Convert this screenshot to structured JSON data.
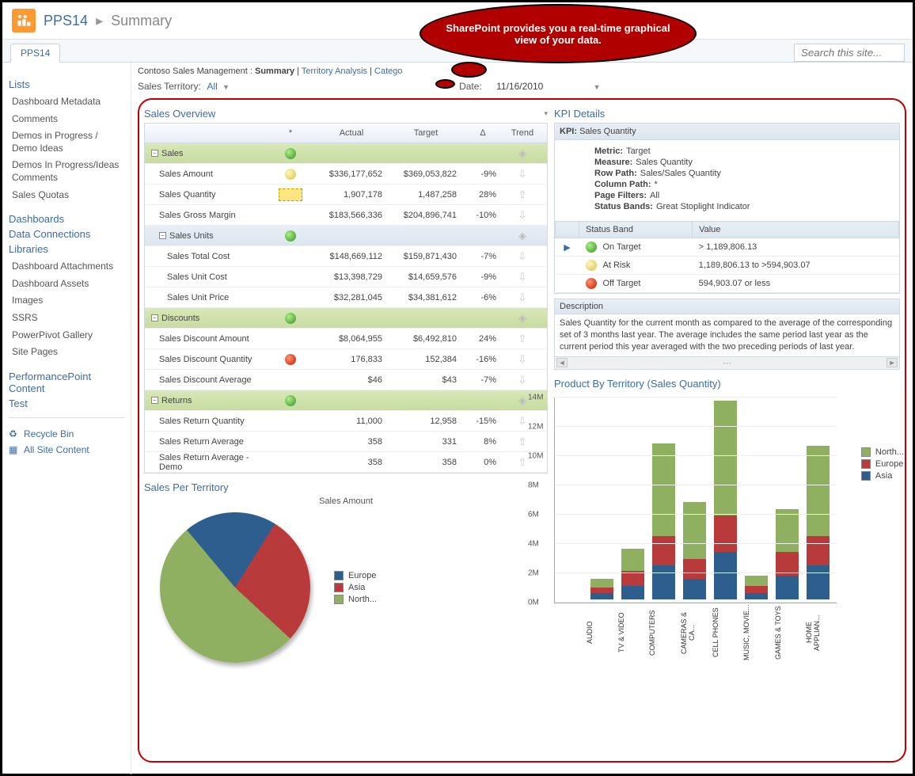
{
  "header": {
    "site": "PPS14",
    "page": "Summary",
    "tab": "PPS14",
    "search_placeholder": "Search this site..."
  },
  "callout": "SharePoint provides you a real-time graphical view of your data.",
  "sidebar": {
    "lists_header": "Lists",
    "lists": [
      "Dashboard Metadata",
      "Comments",
      "Demos in Progress / Demo Ideas",
      "Demos In Progress/Ideas Comments",
      "Sales Quotas"
    ],
    "dashboards": "Dashboards",
    "data_connections": "Data Connections",
    "libraries_header": "Libraries",
    "libraries": [
      "Dashboard Attachments",
      "Dashboard Assets",
      "Images",
      "SSRS",
      "PowerPivot Gallery",
      "Site Pages"
    ],
    "pp_content": "PerformancePoint Content",
    "test": "Test",
    "recycle": "Recycle Bin",
    "all_content": "All Site Content"
  },
  "crumbs": {
    "root": "Contoso Sales Management :",
    "current": "Summary",
    "links": [
      "Territory Analysis",
      "Catego"
    ]
  },
  "filters": {
    "territory_label": "Sales Territory:",
    "territory_value": "All",
    "date_label": "Date:",
    "date_value": "11/16/2010"
  },
  "overview": {
    "title": "Sales Overview",
    "columns": [
      "",
      "*",
      "Actual",
      "Target",
      "Δ",
      "Trend"
    ],
    "rows": [
      {
        "type": "group",
        "label": "Sales",
        "status": "green"
      },
      {
        "type": "item",
        "indent": 1,
        "label": "Sales Amount",
        "status": "yellow",
        "actual": "$336,177,652",
        "target": "$369,053,822",
        "delta": "-9%"
      },
      {
        "type": "item",
        "indent": 1,
        "label": "Sales Quantity",
        "status": "diamond",
        "actual": "1,907,178",
        "target": "1,487,258",
        "delta": "28%"
      },
      {
        "type": "item",
        "indent": 1,
        "label": "Sales Gross Margin",
        "actual": "$183,566,336",
        "target": "$204,896,741",
        "delta": "-10%"
      },
      {
        "type": "subgroup",
        "indent": 1,
        "label": "Sales Units",
        "status": "green"
      },
      {
        "type": "item",
        "indent": 2,
        "label": "Sales Total Cost",
        "actual": "$148,669,112",
        "target": "$159,871,430",
        "delta": "-7%"
      },
      {
        "type": "item",
        "indent": 2,
        "label": "Sales Unit Cost",
        "actual": "$13,398,729",
        "target": "$14,659,576",
        "delta": "-9%"
      },
      {
        "type": "item",
        "indent": 2,
        "label": "Sales Unit Price",
        "actual": "$32,281,045",
        "target": "$34,381,612",
        "delta": "-6%"
      },
      {
        "type": "group",
        "label": "Discounts",
        "status": "green"
      },
      {
        "type": "item",
        "indent": 1,
        "label": "Sales Discount Amount",
        "actual": "$8,064,955",
        "target": "$6,492,810",
        "delta": "24%"
      },
      {
        "type": "item",
        "indent": 1,
        "label": "Sales Discount Quantity",
        "status": "red",
        "actual": "176,833",
        "target": "152,384",
        "delta": "-16%"
      },
      {
        "type": "item",
        "indent": 1,
        "label": "Sales Discount Average",
        "actual": "$46",
        "target": "$43",
        "delta": "-7%"
      },
      {
        "type": "group",
        "label": "Returns",
        "status": "green"
      },
      {
        "type": "item",
        "indent": 1,
        "label": "Sales Return Quantity",
        "actual": "11,000",
        "target": "12,958",
        "delta": "-15%"
      },
      {
        "type": "item",
        "indent": 1,
        "label": "Sales Return Average",
        "actual": "358",
        "target": "331",
        "delta": "8%"
      },
      {
        "type": "item",
        "indent": 1,
        "label": "Sales Return Average - Demo",
        "actual": "358",
        "target": "358",
        "delta": "0%"
      }
    ]
  },
  "kpi": {
    "title": "KPI Details",
    "name_label": "KPI:",
    "name": "Sales Quantity",
    "metric_label": "Metric:",
    "metric": "Target",
    "measure_label": "Measure:",
    "measure": "Sales Quantity",
    "rowpath_label": "Row Path:",
    "rowpath": "Sales/Sales Quantity",
    "colpath_label": "Column Path:",
    "colpath": "*",
    "pagefilters_label": "Page Filters:",
    "pagefilters": "All",
    "statusbands_label": "Status Bands:",
    "statusbands": "Great Stoplight Indicator",
    "band_header": [
      "Status Band",
      "Value"
    ],
    "bands": [
      {
        "color": "green",
        "label": "On Target",
        "value": "> 1,189,806.13",
        "selected": true
      },
      {
        "color": "yellow",
        "label": "At Risk",
        "value": "1,189,806.13 to >594,903.07"
      },
      {
        "color": "red",
        "label": "Off Target",
        "value": "594,903.07 or less"
      }
    ],
    "desc_label": "Description",
    "desc": "Sales Quantity for the current month as compared to the average of the corresponding set of 3 months last year. The average includes the same period last year as the current period this year averaged with the two preceding periods of last year."
  },
  "territory_pie": {
    "title": "Sales Per Territory",
    "subtitle": "Sales Amount",
    "legend": [
      "Europe",
      "Asia",
      "North..."
    ]
  },
  "territory_bar": {
    "title": "Product By Territory (Sales Quantity)",
    "legend": [
      "North...",
      "Europe",
      "Asia"
    ]
  },
  "chart_data": [
    {
      "type": "pie",
      "title": "Sales Per Territory — Sales Amount",
      "series": [
        {
          "name": "Europe",
          "value": 20,
          "color": "#2e5e8e"
        },
        {
          "name": "Asia",
          "value": 28,
          "color": "#b83a3a"
        },
        {
          "name": "North...",
          "value": 52,
          "color": "#8fb060"
        }
      ]
    },
    {
      "type": "bar",
      "stacked": true,
      "title": "Product By Territory (Sales Quantity)",
      "ylabel": "",
      "ylim": [
        0,
        14000000
      ],
      "yticks": [
        "0M",
        "2M",
        "4M",
        "6M",
        "8M",
        "10M",
        "12M",
        "14M"
      ],
      "categories": [
        "AUDIO",
        "TV & VIDEO",
        "COMPUTERS",
        "CAMERAS & CA...",
        "CELL PHONES",
        "MUSIC, MOVIE...",
        "GAMES & TOYS",
        "HOME APPLIAN..."
      ],
      "series": [
        {
          "name": "Asia",
          "color": "#2e5e8e",
          "values": [
            400000,
            900000,
            2300000,
            1400000,
            3200000,
            400000,
            1600000,
            2300000
          ]
        },
        {
          "name": "Europe",
          "color": "#b83a3a",
          "values": [
            400000,
            1000000,
            2000000,
            1300000,
            2500000,
            500000,
            1600000,
            2000000
          ]
        },
        {
          "name": "North...",
          "color": "#8fb060",
          "values": [
            600000,
            1500000,
            6300000,
            3900000,
            7800000,
            700000,
            2900000,
            6100000
          ]
        }
      ]
    }
  ],
  "colors": {
    "blue": "#2e5e8e",
    "red": "#b83a3a",
    "green": "#8fb060"
  }
}
